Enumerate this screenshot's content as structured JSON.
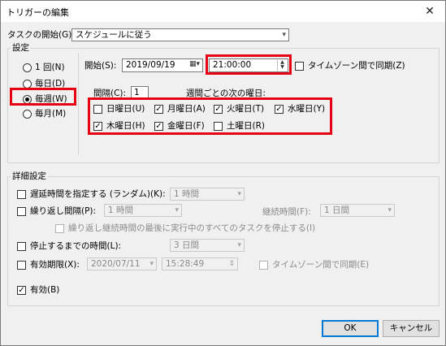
{
  "window": {
    "title": "トリガーの編集",
    "close_icon": "close-icon"
  },
  "task_start": {
    "label": "タスクの開始(G):",
    "value": "スケジュールに従う"
  },
  "settings": {
    "group_title": "設定",
    "radios": [
      {
        "label": "1 回(N)",
        "checked": false
      },
      {
        "label": "毎日(D)",
        "checked": false
      },
      {
        "label": "毎週(W)",
        "checked": true
      },
      {
        "label": "毎月(M)",
        "checked": false
      }
    ],
    "start_label": "開始(S):",
    "start_date": "2019/09/19",
    "start_time": "21:00:00",
    "sync_timezone": "タイムゾーン間で同期(Z)",
    "interval_label": "間隔(C):",
    "interval_value": "1",
    "weekday_title": "週間ごとの次の曜日:",
    "days": [
      {
        "label": "日曜日(U)",
        "checked": false
      },
      {
        "label": "月曜日(A)",
        "checked": true
      },
      {
        "label": "火曜日(T)",
        "checked": true
      },
      {
        "label": "水曜日(Y)",
        "checked": true
      },
      {
        "label": "木曜日(H)",
        "checked": true
      },
      {
        "label": "金曜日(F)",
        "checked": true
      },
      {
        "label": "土曜日(R)",
        "checked": false
      }
    ]
  },
  "advanced": {
    "group_title": "詳細設定",
    "delay_label": "遅延時間を指定する (ランダム)(K):",
    "delay_value": "1 時間",
    "repeat_label": "繰り返し間隔(P):",
    "repeat_value": "1 時間",
    "duration_label": "継続時間(F):",
    "duration_value": "1 日間",
    "stop_all_label": "繰り返し継続時間の最後に実行中のすべてのタスクを停止する(I)",
    "stop_after_label": "停止するまでの時間(L):",
    "stop_after_value": "3 日間",
    "expire_label": "有効期限(X):",
    "expire_date": "2020/07/11",
    "expire_time": "15:28:49",
    "expire_sync": "タイムゾーン間で同期(E)",
    "enabled_label": "有効(B)",
    "enabled_checked": true
  },
  "buttons": {
    "ok": "OK",
    "cancel": "キャンセル"
  },
  "highlight_color": "#e60012"
}
